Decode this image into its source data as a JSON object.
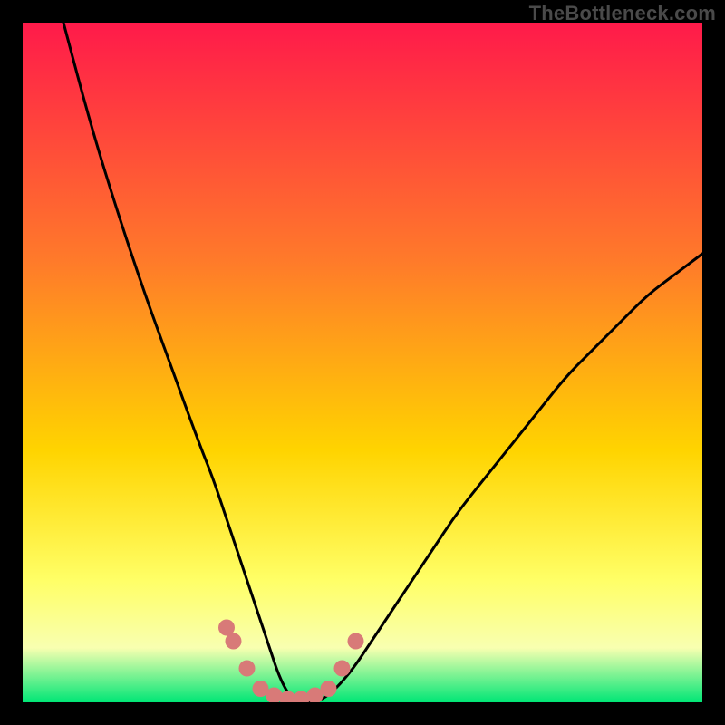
{
  "watermark": "TheBottleneck.com",
  "colors": {
    "frame": "#000000",
    "gradient_top": "#ff1a4a",
    "gradient_mid_upper": "#ff7a2a",
    "gradient_mid": "#ffd400",
    "gradient_low1": "#ffff66",
    "gradient_low2": "#f8ffb0",
    "gradient_bottom": "#00e676",
    "curve": "#000000",
    "dots": "#d87a78"
  },
  "chart_data": {
    "type": "line",
    "title": "",
    "xlabel": "",
    "ylabel": "",
    "xlim": [
      0,
      100
    ],
    "ylim": [
      0,
      100
    ],
    "series": [
      {
        "name": "curve",
        "x": [
          6,
          10,
          14,
          18,
          22,
          26,
          28,
          30,
          32,
          34,
          36,
          38,
          40,
          44,
          48,
          52,
          56,
          60,
          64,
          68,
          72,
          76,
          80,
          84,
          88,
          92,
          96,
          100
        ],
        "values": [
          100,
          85,
          72,
          60,
          49,
          38,
          33,
          27,
          21,
          15,
          9,
          3,
          0,
          0,
          4,
          10,
          16,
          22,
          28,
          33,
          38,
          43,
          48,
          52,
          56,
          60,
          63,
          66
        ]
      }
    ],
    "annotations": {
      "valley_dots": [
        {
          "x": 30,
          "y": 11
        },
        {
          "x": 31,
          "y": 9
        },
        {
          "x": 33,
          "y": 5
        },
        {
          "x": 35,
          "y": 2
        },
        {
          "x": 37,
          "y": 1
        },
        {
          "x": 39,
          "y": 0.5
        },
        {
          "x": 41,
          "y": 0.5
        },
        {
          "x": 43,
          "y": 1
        },
        {
          "x": 45,
          "y": 2
        },
        {
          "x": 47,
          "y": 5
        },
        {
          "x": 49,
          "y": 9
        }
      ]
    }
  }
}
